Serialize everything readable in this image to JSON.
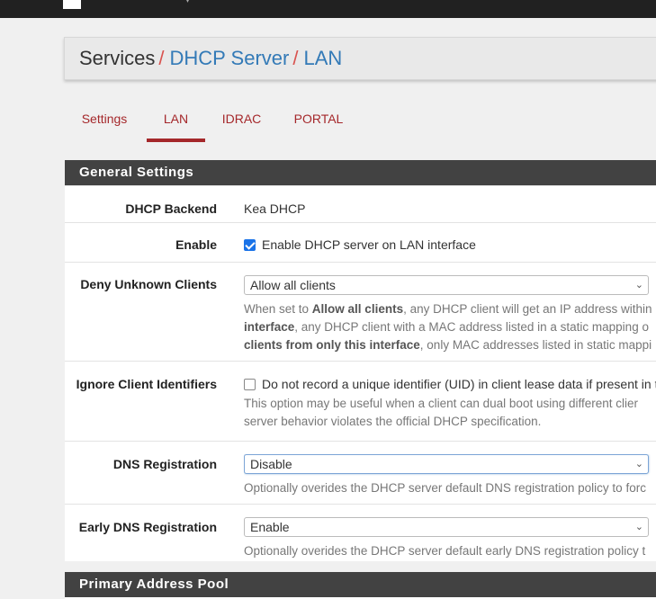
{
  "breadcrumb": {
    "item1": "Services",
    "item2": "DHCP Server",
    "item3": "LAN",
    "separator": "/"
  },
  "tabs": [
    {
      "label": "Settings",
      "active": false
    },
    {
      "label": "LAN",
      "active": true
    },
    {
      "label": "IDRAC",
      "active": false
    },
    {
      "label": "PORTAL",
      "active": false
    }
  ],
  "general": {
    "heading": "General Settings",
    "dhcp_backend": {
      "label": "DHCP Backend",
      "value": "Kea DHCP"
    },
    "enable": {
      "label": "Enable",
      "checkbox_label": "Enable DHCP server on LAN interface",
      "checked": true
    },
    "deny_unknown": {
      "label": "Deny Unknown Clients",
      "selected": "Allow all clients",
      "help_l1_pre": "When set to ",
      "help_l1_bold": "Allow all clients",
      "help_l1_post": ", any DHCP client will get an IP address within",
      "help_l2_bold": "interface",
      "help_l2_post": ", any DHCP client with a MAC address listed in a static mapping o",
      "help_l3_bold": "clients from only this interface",
      "help_l3_post": ", only MAC addresses listed in static mappi"
    },
    "ignore_client_ids": {
      "label": "Ignore Client Identifiers",
      "checkbox_label": "Do not record a unique identifier (UID) in client lease data if present in t",
      "checked": false,
      "help_l1": "This option may be useful when a client can dual boot using different clier",
      "help_l2": "server behavior violates the official DHCP specification."
    },
    "dns_registration": {
      "label": "DNS Registration",
      "selected": "Disable",
      "help": "Optionally overides the DHCP server default DNS registration policy to forc"
    },
    "early_dns_registration": {
      "label": "Early DNS Registration",
      "selected": "Enable",
      "help": "Optionally overides the DHCP server default early DNS registration policy t"
    }
  },
  "pool": {
    "heading": "Primary Address Pool"
  },
  "icons": {
    "chevron": "⌄"
  },
  "colors": {
    "tab_active": "#a5282b",
    "link": "#337ab7",
    "separator": "#d9534f",
    "panel_heading": "#424242",
    "checkbox": "#1a73e8"
  }
}
